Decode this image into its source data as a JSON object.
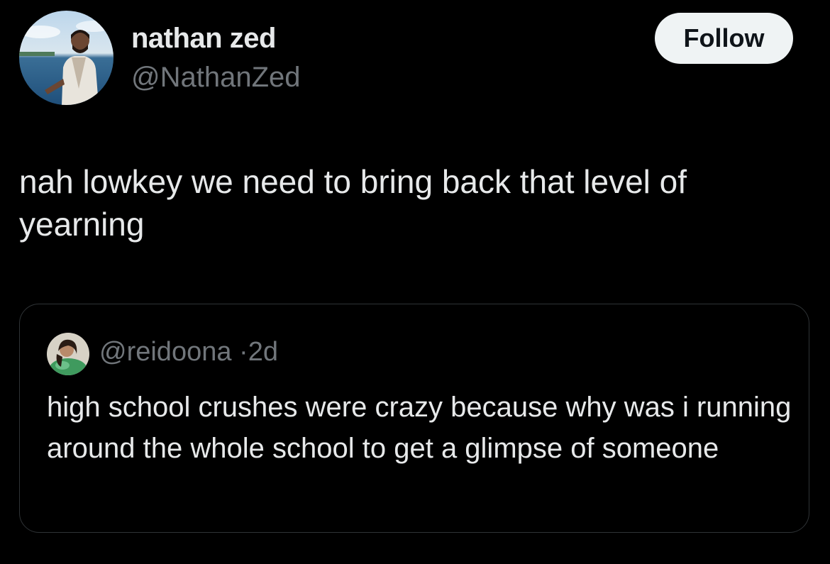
{
  "author": {
    "display_name": "nathan zed",
    "handle": "@NathanZed",
    "avatar_icon": "profile-photo"
  },
  "follow_label": "Follow",
  "tweet": {
    "text": "nah lowkey we need to bring back that level of yearning"
  },
  "quoted_tweet": {
    "handle": "@reidoona",
    "separator": "·",
    "time": "2d",
    "text": "high school crushes were crazy because why was i running around the whole school to get a glimpse of someone",
    "avatar_icon": "profile-photo"
  },
  "colors": {
    "background": "#000000",
    "primary_text": "#e7e9ea",
    "secondary_text": "#71767b",
    "border": "#2f3336",
    "button_bg": "#eff3f4",
    "button_text": "#0f1419"
  }
}
